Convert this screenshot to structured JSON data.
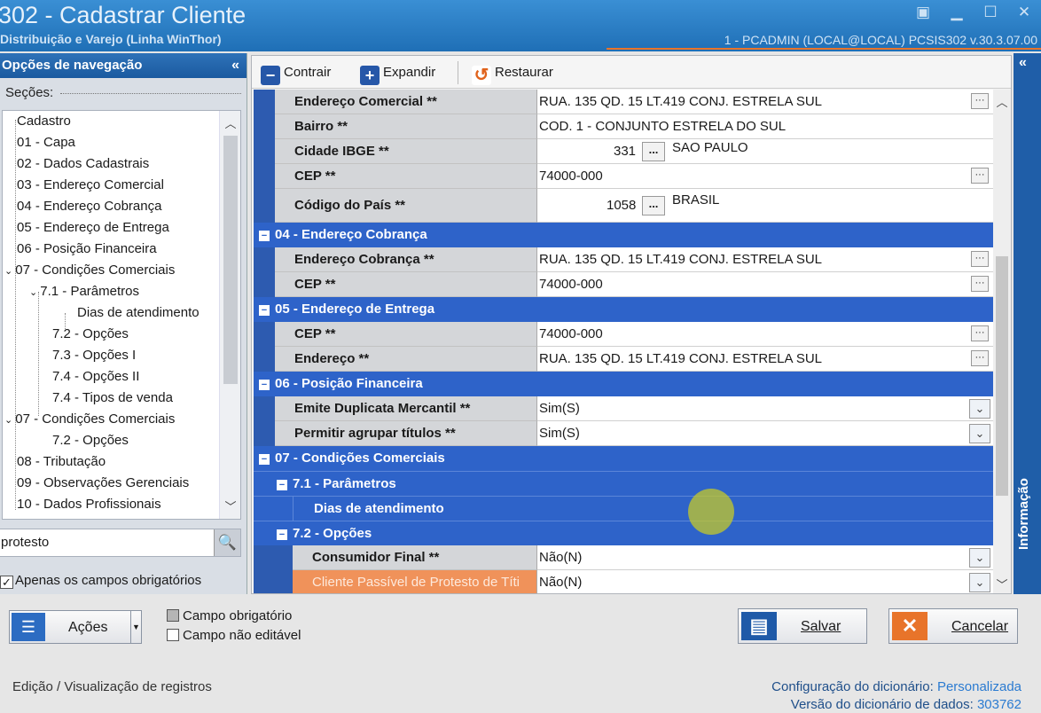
{
  "window": {
    "title": "302 - Cadastrar Cliente",
    "subtitle": "Distribuição e Varejo (Linha WinThor)",
    "userinfo": "1 - PCADMIN (LOCAL@LOCAL)   PCSIS302  v.30.3.07.00"
  },
  "nav": {
    "header": "Opções de navegação",
    "sections_label": "Seções:",
    "items": [
      "Cadastro",
      "01 - Capa",
      "02 - Dados Cadastrais",
      "03 - Endereço Comercial",
      "04 - Endereço Cobrança",
      "05 - Endereço de Entrega",
      "06 - Posição Financeira",
      "07 - Condições Comerciais",
      "7.1 - Parâmetros",
      "Dias de atendimento",
      "7.2 - Opções",
      "7.3 - Opções I",
      "7.4 - Opções II",
      "7.4 - Tipos de venda",
      "07 - Condições Comerciais",
      "7.2 - Opções",
      "08 - Tributação",
      "09 - Observações Gerenciais",
      "10 - Dados Profissionais"
    ],
    "search_value": "protesto",
    "only_required_label": "Apenas os campos obrigatórios",
    "only_required_checked": true
  },
  "toolbar": {
    "contrair": "Contrair",
    "expandir": "Expandir",
    "restaurar": "Restaurar"
  },
  "grid": {
    "rows": [
      {
        "label": "Endereço Comercial **",
        "value": "RUA. 135 QD. 15 LT.419 CONJ. ESTRELA SUL"
      },
      {
        "label": "Bairro **",
        "value": "COD. 1 - CONJUNTO ESTRELA DO SUL"
      },
      {
        "label": "Cidade IBGE **",
        "code": "331",
        "value": "SAO PAULO"
      },
      {
        "label": "CEP **",
        "value": "74000-000"
      },
      {
        "label": "Código do País **",
        "code": "1058",
        "value": "BRASIL"
      },
      {
        "header": "04 - Endereço Cobrança"
      },
      {
        "label": "Endereço Cobrança **",
        "value": "RUA. 135 QD. 15 LT.419 CONJ. ESTRELA SUL"
      },
      {
        "label": "CEP **",
        "value": "74000-000"
      },
      {
        "header": "05 - Endereço de Entrega"
      },
      {
        "label": "CEP **",
        "value": "74000-000"
      },
      {
        "label": "Endereço **",
        "value": "RUA. 135 QD. 15 LT.419 CONJ. ESTRELA SUL"
      },
      {
        "header": "06 - Posição Financeira"
      },
      {
        "label": "Emite Duplicata Mercantil **",
        "value": "Sim(S)"
      },
      {
        "label": "Permitir agrupar títulos **",
        "value": "Sim(S)"
      },
      {
        "header": "07 - Condições Comerciais"
      },
      {
        "subheader": "7.1 - Parâmetros"
      },
      {
        "subsub": "Dias de atendimento"
      },
      {
        "subheader": "7.2 - Opções"
      },
      {
        "label": "Consumidor Final **",
        "value": "Não(N)"
      },
      {
        "label": "Cliente Passível de Protesto de Títi",
        "value": "Não(N)"
      }
    ]
  },
  "info_strip_label": "Informação",
  "bottom": {
    "acoes": "Ações",
    "legend_required": "Campo obrigatório",
    "legend_noneditable": "Campo não editável",
    "salvar": "Salvar",
    "cancelar": "Cancelar",
    "status_left": "Edição / Visualização de registros",
    "dict_config_label": "Configuração do dicionário:",
    "dict_config_value": "Personalizada",
    "dict_version_label": "Versão do dicionário de dados:",
    "dict_version_value": "303762"
  },
  "colors": {
    "title_blue": "#1f6fb6",
    "section_header_blue": "#2e63c9",
    "highlight_orange": "#f0925a",
    "accent_orange": "#e8742a"
  }
}
